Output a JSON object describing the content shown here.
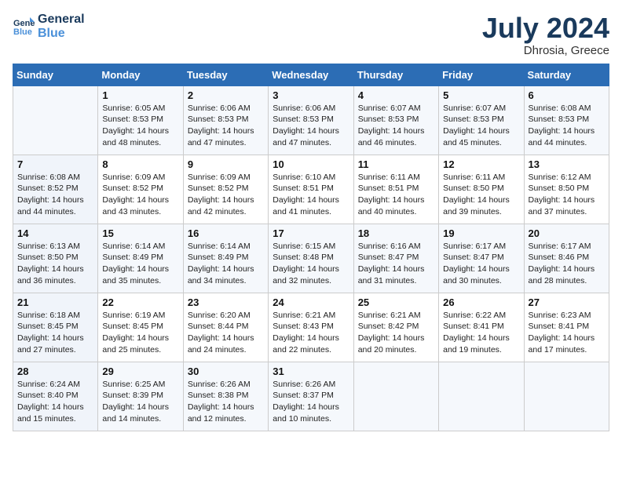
{
  "header": {
    "logo_line1": "General",
    "logo_line2": "Blue",
    "month_year": "July 2024",
    "location": "Dhrosia, Greece"
  },
  "weekdays": [
    "Sunday",
    "Monday",
    "Tuesday",
    "Wednesday",
    "Thursday",
    "Friday",
    "Saturday"
  ],
  "weeks": [
    [
      {
        "day": "",
        "info": ""
      },
      {
        "day": "1",
        "info": "Sunrise: 6:05 AM\nSunset: 8:53 PM\nDaylight: 14 hours\nand 48 minutes."
      },
      {
        "day": "2",
        "info": "Sunrise: 6:06 AM\nSunset: 8:53 PM\nDaylight: 14 hours\nand 47 minutes."
      },
      {
        "day": "3",
        "info": "Sunrise: 6:06 AM\nSunset: 8:53 PM\nDaylight: 14 hours\nand 47 minutes."
      },
      {
        "day": "4",
        "info": "Sunrise: 6:07 AM\nSunset: 8:53 PM\nDaylight: 14 hours\nand 46 minutes."
      },
      {
        "day": "5",
        "info": "Sunrise: 6:07 AM\nSunset: 8:53 PM\nDaylight: 14 hours\nand 45 minutes."
      },
      {
        "day": "6",
        "info": "Sunrise: 6:08 AM\nSunset: 8:53 PM\nDaylight: 14 hours\nand 44 minutes."
      }
    ],
    [
      {
        "day": "7",
        "info": "Sunrise: 6:08 AM\nSunset: 8:52 PM\nDaylight: 14 hours\nand 44 minutes."
      },
      {
        "day": "8",
        "info": "Sunrise: 6:09 AM\nSunset: 8:52 PM\nDaylight: 14 hours\nand 43 minutes."
      },
      {
        "day": "9",
        "info": "Sunrise: 6:09 AM\nSunset: 8:52 PM\nDaylight: 14 hours\nand 42 minutes."
      },
      {
        "day": "10",
        "info": "Sunrise: 6:10 AM\nSunset: 8:51 PM\nDaylight: 14 hours\nand 41 minutes."
      },
      {
        "day": "11",
        "info": "Sunrise: 6:11 AM\nSunset: 8:51 PM\nDaylight: 14 hours\nand 40 minutes."
      },
      {
        "day": "12",
        "info": "Sunrise: 6:11 AM\nSunset: 8:50 PM\nDaylight: 14 hours\nand 39 minutes."
      },
      {
        "day": "13",
        "info": "Sunrise: 6:12 AM\nSunset: 8:50 PM\nDaylight: 14 hours\nand 37 minutes."
      }
    ],
    [
      {
        "day": "14",
        "info": "Sunrise: 6:13 AM\nSunset: 8:50 PM\nDaylight: 14 hours\nand 36 minutes."
      },
      {
        "day": "15",
        "info": "Sunrise: 6:14 AM\nSunset: 8:49 PM\nDaylight: 14 hours\nand 35 minutes."
      },
      {
        "day": "16",
        "info": "Sunrise: 6:14 AM\nSunset: 8:49 PM\nDaylight: 14 hours\nand 34 minutes."
      },
      {
        "day": "17",
        "info": "Sunrise: 6:15 AM\nSunset: 8:48 PM\nDaylight: 14 hours\nand 32 minutes."
      },
      {
        "day": "18",
        "info": "Sunrise: 6:16 AM\nSunset: 8:47 PM\nDaylight: 14 hours\nand 31 minutes."
      },
      {
        "day": "19",
        "info": "Sunrise: 6:17 AM\nSunset: 8:47 PM\nDaylight: 14 hours\nand 30 minutes."
      },
      {
        "day": "20",
        "info": "Sunrise: 6:17 AM\nSunset: 8:46 PM\nDaylight: 14 hours\nand 28 minutes."
      }
    ],
    [
      {
        "day": "21",
        "info": "Sunrise: 6:18 AM\nSunset: 8:45 PM\nDaylight: 14 hours\nand 27 minutes."
      },
      {
        "day": "22",
        "info": "Sunrise: 6:19 AM\nSunset: 8:45 PM\nDaylight: 14 hours\nand 25 minutes."
      },
      {
        "day": "23",
        "info": "Sunrise: 6:20 AM\nSunset: 8:44 PM\nDaylight: 14 hours\nand 24 minutes."
      },
      {
        "day": "24",
        "info": "Sunrise: 6:21 AM\nSunset: 8:43 PM\nDaylight: 14 hours\nand 22 minutes."
      },
      {
        "day": "25",
        "info": "Sunrise: 6:21 AM\nSunset: 8:42 PM\nDaylight: 14 hours\nand 20 minutes."
      },
      {
        "day": "26",
        "info": "Sunrise: 6:22 AM\nSunset: 8:41 PM\nDaylight: 14 hours\nand 19 minutes."
      },
      {
        "day": "27",
        "info": "Sunrise: 6:23 AM\nSunset: 8:41 PM\nDaylight: 14 hours\nand 17 minutes."
      }
    ],
    [
      {
        "day": "28",
        "info": "Sunrise: 6:24 AM\nSunset: 8:40 PM\nDaylight: 14 hours\nand 15 minutes."
      },
      {
        "day": "29",
        "info": "Sunrise: 6:25 AM\nSunset: 8:39 PM\nDaylight: 14 hours\nand 14 minutes."
      },
      {
        "day": "30",
        "info": "Sunrise: 6:26 AM\nSunset: 8:38 PM\nDaylight: 14 hours\nand 12 minutes."
      },
      {
        "day": "31",
        "info": "Sunrise: 6:26 AM\nSunset: 8:37 PM\nDaylight: 14 hours\nand 10 minutes."
      },
      {
        "day": "",
        "info": ""
      },
      {
        "day": "",
        "info": ""
      },
      {
        "day": "",
        "info": ""
      }
    ]
  ]
}
